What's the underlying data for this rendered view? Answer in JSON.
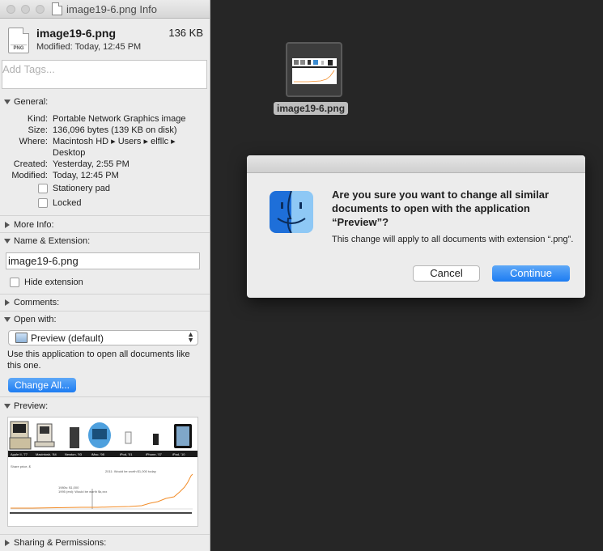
{
  "info": {
    "window_title": "image19-6.png Info",
    "file_name": "image19-6.png",
    "file_size": "136 KB",
    "modified": "Modified: Today, 12:45 PM",
    "file_icon_label": "PNG",
    "tags_placeholder": "Add Tags...",
    "general": {
      "label": "General:",
      "rows": [
        {
          "key": "Kind:",
          "value": "Portable Network Graphics image"
        },
        {
          "key": "Size:",
          "value": "136,096 bytes (139 KB on disk)"
        },
        {
          "key": "Where:",
          "value": "Macintosh HD ▸ Users ▸ elfllc ▸ Desktop"
        },
        {
          "key": "Created:",
          "value": "Yesterday, 2:55 PM"
        },
        {
          "key": "Modified:",
          "value": "Today, 12:45 PM"
        }
      ],
      "stationery_label": "Stationery pad",
      "locked_label": "Locked"
    },
    "more_info_label": "More Info:",
    "name_ext": {
      "label": "Name & Extension:",
      "value": "image19-6.png",
      "hide_extension_label": "Hide extension"
    },
    "comments_label": "Comments:",
    "open_with": {
      "label": "Open with:",
      "selected": "Preview (default)",
      "note": "Use this application to open all documents like this one.",
      "change_all_label": "Change All..."
    },
    "preview_label": "Preview:",
    "preview_captions": [
      "Apple II, '77",
      "Macintosh, '84",
      "Newton, '93",
      "iMac, '98",
      "iPod, '01",
      "iPhone, '07",
      "iPad, '10"
    ],
    "preview_chart_text": [
      "Share price, $",
      "2011: Would be worth $1,000 today",
      "1980s: $1,000",
      "1995 (est): Would be worth $x,xxx"
    ],
    "sharing_label": "Sharing & Permissions:"
  },
  "desktop": {
    "file_label": "image19-6.png"
  },
  "dialog": {
    "question": "Are you sure you want to change all similar documents to open with the application “Preview”?",
    "info": "This change will apply to all documents with extension “.png”.",
    "cancel_label": "Cancel",
    "continue_label": "Continue"
  },
  "colors": {
    "accent": "#1d7cf2",
    "desktop_bg": "#262626",
    "panel_bg": "#ececec",
    "chart_line": "#f28c28"
  }
}
